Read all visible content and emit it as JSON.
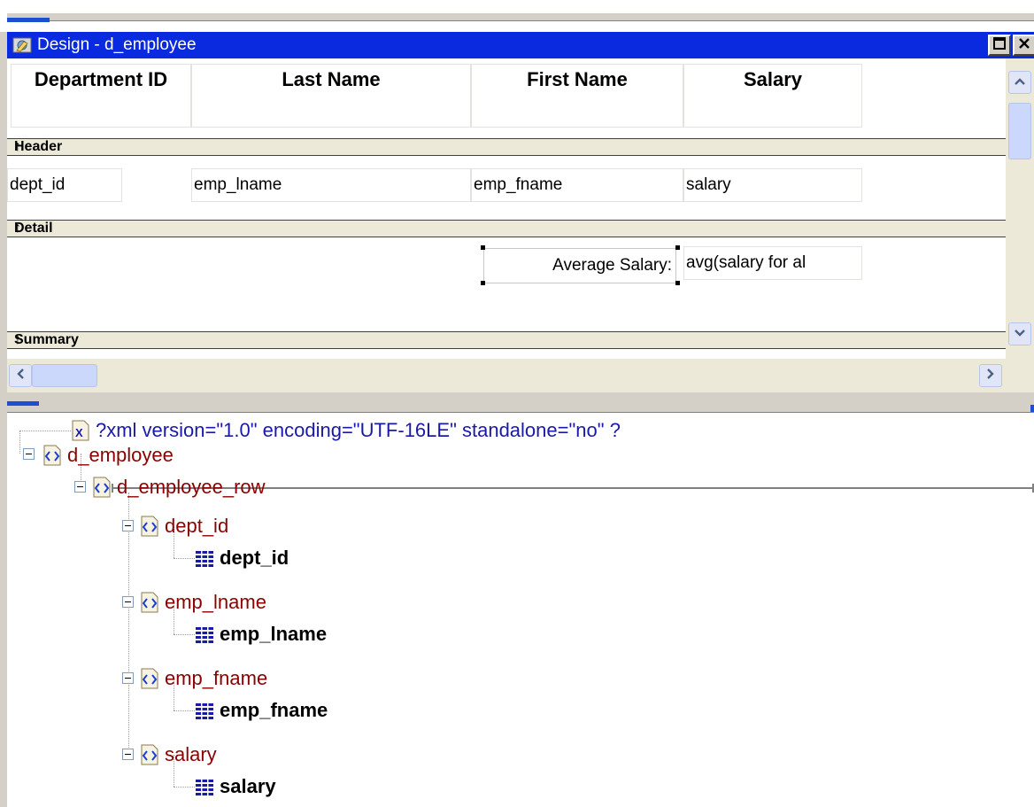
{
  "window": {
    "title": "Design - d_employee",
    "title_bar_color": "#0a2adf"
  },
  "design": {
    "columns": [
      {
        "header": "Department ID",
        "field": "dept_id"
      },
      {
        "header": "Last Name",
        "field": "emp_lname"
      },
      {
        "header": "First Name",
        "field": "emp_fname"
      },
      {
        "header": "Salary",
        "field": "salary"
      }
    ],
    "bands": {
      "header": "Header",
      "detail": "Detail",
      "summary": "Summary",
      "band_marker": "↑"
    },
    "summary_label": "Average Salary:",
    "summary_expression": "avg(salary for al"
  },
  "tree": {
    "declaration": "?xml version=\"1.0\" encoding=\"UTF-16LE\" standalone=\"no\" ?",
    "root": "d_employee",
    "row": "d_employee_row",
    "elements": [
      {
        "element": "dept_id",
        "value": "dept_id"
      },
      {
        "element": "emp_lname",
        "value": "emp_lname"
      },
      {
        "element": "emp_fname",
        "value": "emp_fname"
      },
      {
        "element": "salary",
        "value": "salary"
      }
    ]
  },
  "icons": {
    "app": "design-icon",
    "maximize": "maximize-icon",
    "close": "close-icon",
    "xml_declaration": "xml-declaration-icon",
    "element": "xml-element-icon",
    "data": "column-data-icon"
  }
}
